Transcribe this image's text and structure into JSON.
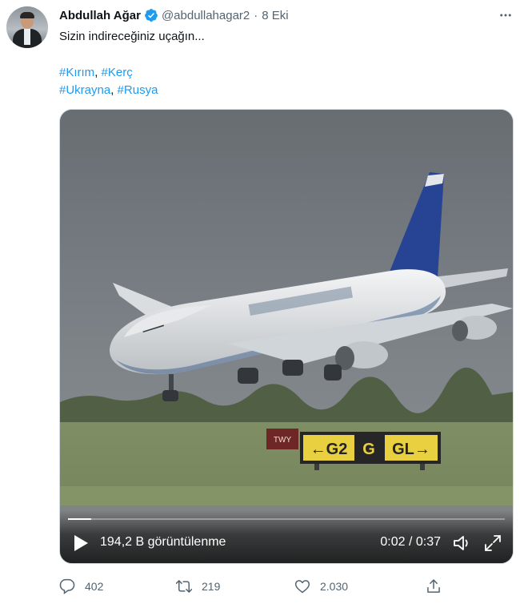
{
  "author": {
    "name": "Abdullah Ağar",
    "handle": "@abdullahagar2",
    "separator": "·",
    "time": "8 Eki"
  },
  "tweet": {
    "text": "Sizin indireceğiniz uçağın...",
    "hashtags_line1": [
      "#Kırım",
      "#Kerç"
    ],
    "hashtags_line2": [
      "#Ukrayna",
      "#Rusya"
    ],
    "hashtag_separator": ", "
  },
  "video": {
    "views": "194,2 B görüntülenme",
    "timecode": "0:02 / 0:37",
    "progress": 0.054,
    "sign_left": "←G2",
    "sign_mid": "G",
    "sign_right": "GL→",
    "sign_red": "TWY"
  },
  "actions": {
    "replies": "402",
    "retweets": "219",
    "likes": "2.030"
  },
  "colors": {
    "accent": "#1d9bf0",
    "text_primary": "#0f1419",
    "text_secondary": "#536471"
  },
  "icons": {
    "verified": "verified-badge-icon",
    "more": "more-horizontal-icon",
    "play": "play-icon",
    "volume": "volume-icon",
    "fullscreen": "fullscreen-icon",
    "reply": "reply-icon",
    "retweet": "retweet-icon",
    "like": "heart-icon",
    "share": "share-icon"
  }
}
